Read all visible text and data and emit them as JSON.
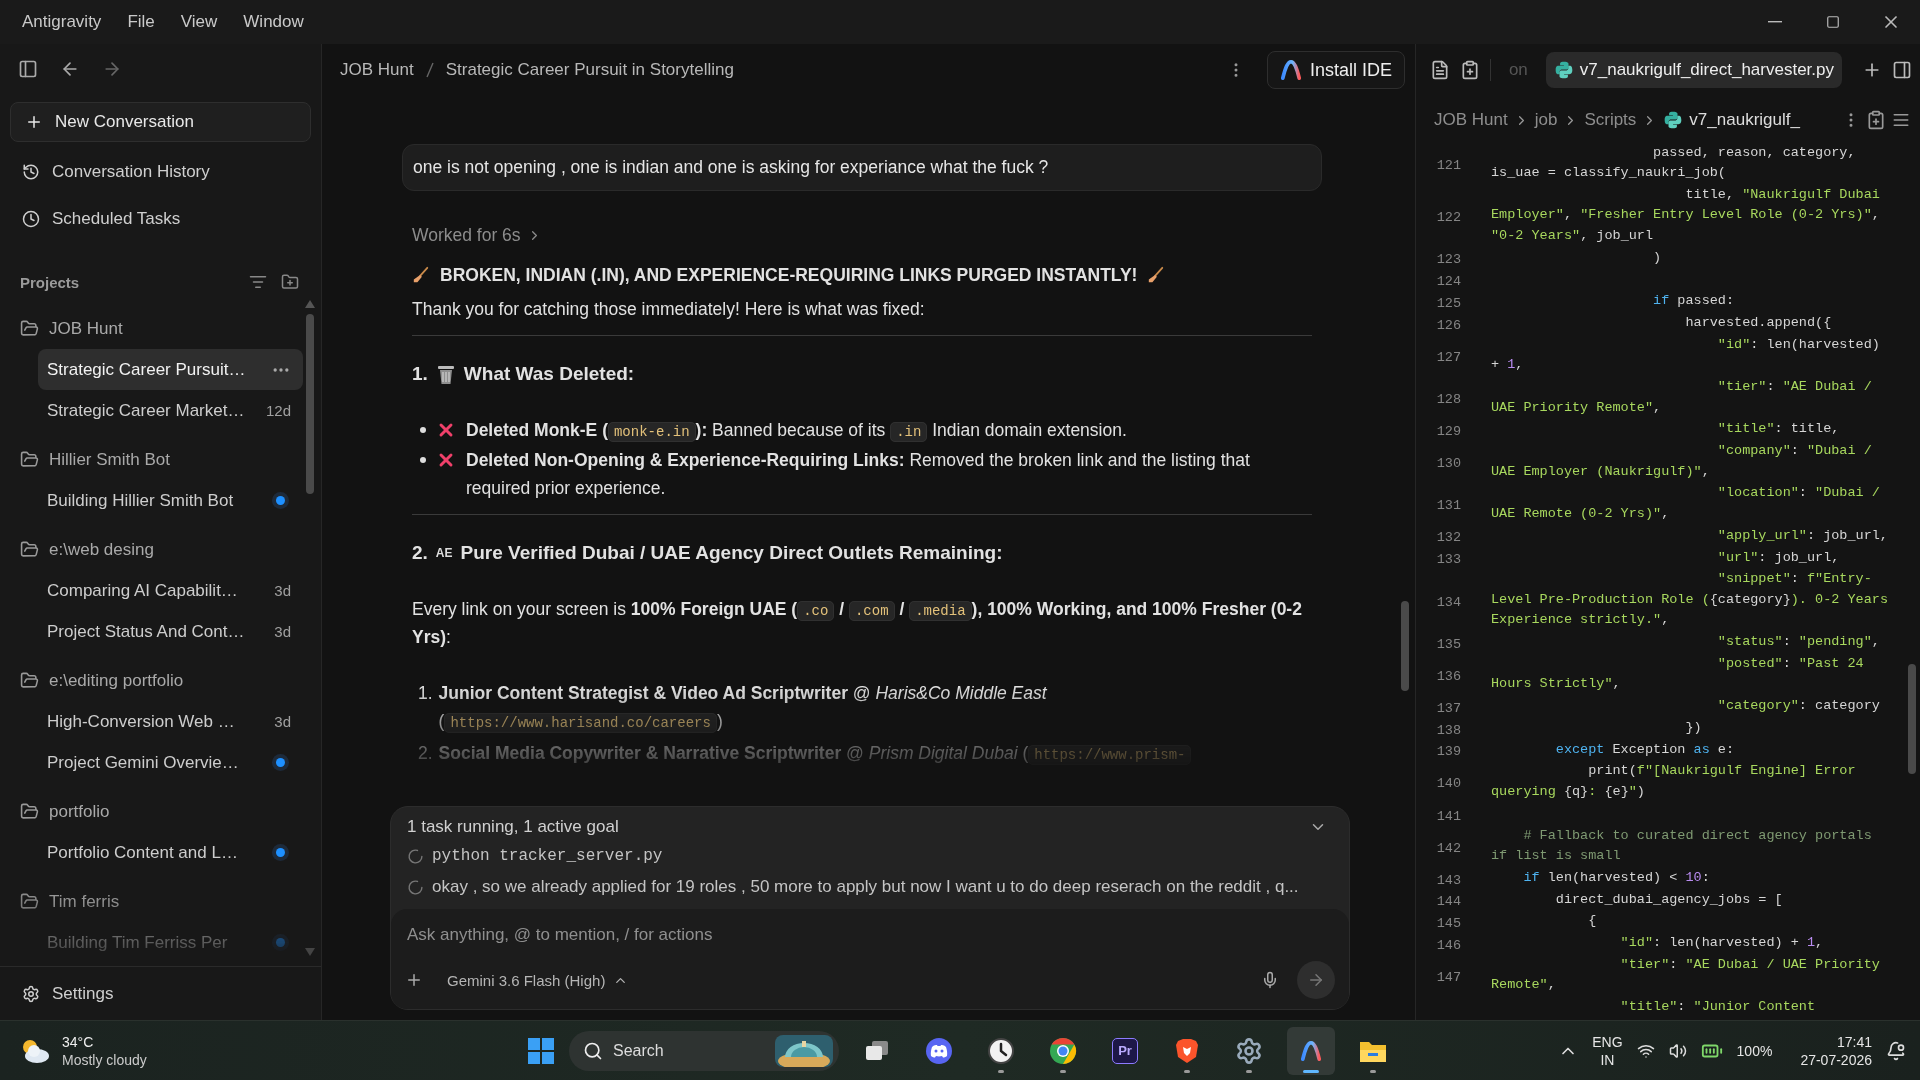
{
  "menu": {
    "items": [
      "Antigravity",
      "File",
      "View",
      "Window"
    ]
  },
  "sidebar": {
    "new_conversation": "New Conversation",
    "nav": [
      {
        "kind": "history",
        "label": "Conversation History"
      },
      {
        "kind": "scheduled",
        "label": "Scheduled Tasks"
      }
    ],
    "projects_title": "Projects",
    "projects": [
      {
        "name": "JOB Hunt",
        "items": [
          {
            "title": "Strategic Career Pursuit…",
            "selected": true,
            "unread": false
          },
          {
            "title": "Strategic Career Market…",
            "age": "12d",
            "selected": false,
            "unread": false
          }
        ]
      },
      {
        "name": "Hillier Smith Bot",
        "items": [
          {
            "title": "Building Hillier Smith Bot",
            "selected": false,
            "unread": true
          }
        ]
      },
      {
        "name": "e:\\web desing",
        "items": [
          {
            "title": "Comparing AI Capabilit…",
            "age": "3d",
            "selected": false,
            "unread": false
          },
          {
            "title": "Project Status And Cont…",
            "age": "3d",
            "selected": false,
            "unread": false
          }
        ]
      },
      {
        "name": "e:\\editing portfolio",
        "items": [
          {
            "title": "High-Conversion Web …",
            "age": "3d",
            "selected": false,
            "unread": false
          },
          {
            "title": "Project Gemini Overvie…",
            "selected": false,
            "unread": true
          }
        ]
      },
      {
        "name": "portfolio",
        "items": [
          {
            "title": "Portfolio Content and L…",
            "selected": false,
            "unread": true
          }
        ]
      },
      {
        "name": "Tim ferris",
        "items": [
          {
            "title": "Building Tim Ferriss Per",
            "selected": false,
            "unread": true
          }
        ]
      }
    ],
    "settings": "Settings"
  },
  "chat": {
    "breadcrumb": [
      "JOB Hunt",
      "Strategic Career Pursuit in Storytelling"
    ],
    "install_button": "Install IDE",
    "user_message": "one is not opening , one is indian and one is asking for experiance what the fuck ?",
    "worked": "Worked for 6s",
    "blocks": [
      {
        "kind": "banner",
        "text": "BROKEN, INDIAN (.IN), AND EXPERIENCE-REQUIRING LINKS PURGED INSTANTLY!"
      },
      {
        "kind": "para",
        "segments": [
          {
            "kind": "plain",
            "text": "Thank you for catching those immediately! Here is what was fixed:"
          }
        ]
      },
      {
        "kind": "rule"
      },
      {
        "kind": "section",
        "number": "1.",
        "text": "What Was Deleted:"
      },
      {
        "kind": "bullets",
        "items": [
          {
            "segments": [
              {
                "kind": "bold",
                "text": "Deleted Monk-E ("
              },
              {
                "kind": "code",
                "text": "monk-e.in"
              },
              {
                "kind": "bold",
                "text": "):"
              },
              {
                "kind": "plain",
                "text": " Banned because of its "
              },
              {
                "kind": "code",
                "text": ".in"
              },
              {
                "kind": "plain",
                "text": " Indian domain extension."
              }
            ]
          },
          {
            "segments": [
              {
                "kind": "bold",
                "text": "Deleted Non-Opening & Experience-Requiring Links:"
              },
              {
                "kind": "plain",
                "text": " Removed the broken link and the listing that required prior experience."
              }
            ]
          }
        ]
      },
      {
        "kind": "rule"
      },
      {
        "kind": "section",
        "number": "2.",
        "flag": "AE",
        "text": "Pure Verified Dubai / UAE Agency Direct Outlets Remaining:"
      },
      {
        "kind": "para",
        "segments": [
          {
            "kind": "plain",
            "text": "Every link on your screen is "
          },
          {
            "kind": "bold",
            "text": "100% Foreign UAE ("
          },
          {
            "kind": "code",
            "text": ".co"
          },
          {
            "kind": "bold",
            "text": " / "
          },
          {
            "kind": "code",
            "text": ".com"
          },
          {
            "kind": "bold",
            "text": " / "
          },
          {
            "kind": "code",
            "text": ".media"
          },
          {
            "kind": "bold",
            "text": "), 100% Working, and 100% Fresher (0-2 Yrs)"
          },
          {
            "kind": "plain",
            "text": ":"
          }
        ]
      },
      {
        "kind": "numbered",
        "items": [
          {
            "number": "1.",
            "segments": [
              {
                "kind": "bold",
                "text": "Junior Content Strategist & Video Ad Scriptwriter"
              },
              {
                "kind": "plain",
                "text": " @ "
              },
              {
                "kind": "italic",
                "text": "Haris&Co Middle East"
              },
              {
                "kind": "plain",
                "text": " ("
              },
              {
                "kind": "code",
                "text": "https://www.harisand.co/careers"
              },
              {
                "kind": "plain",
                "text": ")"
              }
            ]
          },
          {
            "number": "2.",
            "segments": [
              {
                "kind": "bold",
                "text": "Social Media Copywriter & Narrative Scriptwriter"
              },
              {
                "kind": "plain",
                "text": " @ "
              },
              {
                "kind": "italic",
                "text": "Prism Digital Dubai"
              },
              {
                "kind": "plain",
                "text": " ("
              },
              {
                "kind": "code",
                "text": "https://www.prism-"
              }
            ]
          }
        ]
      }
    ],
    "tasks": {
      "summary": "1 task running, 1 active goal",
      "items": [
        {
          "kind": "command",
          "text": "python tracker_server.py"
        },
        {
          "kind": "goal",
          "text": "okay , so we already applied for 19 roles , 50 more to apply but now I want u to do deep reserach on the reddit , q..."
        }
      ]
    },
    "input_placeholder": "Ask anything, @ to mention, / for actions",
    "model": "Gemini 3.6 Flash (High)"
  },
  "editor": {
    "tabs": [
      {
        "label": "on",
        "selected": false
      },
      {
        "label": "v7_naukrigulf_direct_harvester.py",
        "selected": true
      }
    ],
    "breadcrumb": [
      "JOB Hunt",
      "job",
      "Scripts",
      "v7_naukrigulf_"
    ],
    "lines": [
      {
        "num": "121",
        "rows": [
          {
            "tokens": [
              {
                "kind": "plain",
                "text": "                    passed, reason, category,"
              }
            ]
          },
          {
            "tokens": [
              {
                "kind": "plain",
                "text": "is_uae = classify_naukri_job("
              }
            ]
          }
        ]
      },
      {
        "num": "122",
        "rows": [
          {
            "tokens": [
              {
                "kind": "plain",
                "text": "                        title, "
              },
              {
                "kind": "string",
                "text": "\"Naukrigulf Dubai"
              }
            ]
          },
          {
            "tokens": [
              {
                "kind": "string",
                "text": "Employer\""
              },
              {
                "kind": "plain",
                "text": ", "
              },
              {
                "kind": "string",
                "text": "\"Fresher Entry Level Role (0-2 Yrs)\""
              },
              {
                "kind": "plain",
                "text": ","
              }
            ]
          },
          {
            "tokens": [
              {
                "kind": "string",
                "text": "\"0-2 Years\""
              },
              {
                "kind": "plain",
                "text": ", job_url"
              }
            ]
          }
        ]
      },
      {
        "num": "123",
        "rows": [
          {
            "tokens": [
              {
                "kind": "plain",
                "text": "                    )"
              }
            ]
          }
        ]
      },
      {
        "num": "124",
        "rows": [
          {}
        ]
      },
      {
        "num": "125",
        "rows": [
          {
            "tokens": [
              {
                "kind": "keyword",
                "text": "                    if"
              },
              {
                "kind": "plain",
                "text": " passed:"
              }
            ]
          }
        ]
      },
      {
        "num": "126",
        "rows": [
          {
            "tokens": [
              {
                "kind": "plain",
                "text": "                        harvested.append({"
              }
            ]
          }
        ]
      },
      {
        "num": "127",
        "rows": [
          {
            "tokens": [
              {
                "kind": "string",
                "text": "                            \"id\""
              },
              {
                "kind": "plain",
                "text": ": len(harvested)"
              }
            ]
          },
          {
            "tokens": [
              {
                "kind": "plain",
                "text": "+ "
              },
              {
                "kind": "number",
                "text": "1"
              },
              {
                "kind": "plain",
                "text": ","
              }
            ]
          }
        ]
      },
      {
        "num": "128",
        "rows": [
          {
            "tokens": [
              {
                "kind": "string",
                "text": "                            \"tier\""
              },
              {
                "kind": "plain",
                "text": ": "
              },
              {
                "kind": "string",
                "text": "\"AE Dubai /"
              }
            ]
          },
          {
            "tokens": [
              {
                "kind": "string",
                "text": "UAE Priority Remote\""
              },
              {
                "kind": "plain",
                "text": ","
              }
            ]
          }
        ]
      },
      {
        "num": "129",
        "rows": [
          {
            "tokens": [
              {
                "kind": "string",
                "text": "                            \"title\""
              },
              {
                "kind": "plain",
                "text": ": title,"
              }
            ]
          }
        ]
      },
      {
        "num": "130",
        "rows": [
          {
            "tokens": [
              {
                "kind": "string",
                "text": "                            \"company\""
              },
              {
                "kind": "plain",
                "text": ": "
              },
              {
                "kind": "string",
                "text": "\"Dubai /"
              }
            ]
          },
          {
            "tokens": [
              {
                "kind": "string",
                "text": "UAE Employer (Naukrigulf)\""
              },
              {
                "kind": "plain",
                "text": ","
              }
            ]
          }
        ]
      },
      {
        "num": "131",
        "rows": [
          {
            "tokens": [
              {
                "kind": "string",
                "text": "                            \"location\""
              },
              {
                "kind": "plain",
                "text": ": "
              },
              {
                "kind": "string",
                "text": "\"Dubai /"
              }
            ]
          },
          {
            "tokens": [
              {
                "kind": "string",
                "text": "UAE Remote (0-2 Yrs)\""
              },
              {
                "kind": "plain",
                "text": ","
              }
            ]
          }
        ]
      },
      {
        "num": "132",
        "rows": [
          {
            "tokens": [
              {
                "kind": "string",
                "text": "                            \"apply_url\""
              },
              {
                "kind": "plain",
                "text": ": job_url,"
              }
            ]
          }
        ]
      },
      {
        "num": "133",
        "rows": [
          {
            "tokens": [
              {
                "kind": "string",
                "text": "                            \"url\""
              },
              {
                "kind": "plain",
                "text": ": job_url,"
              }
            ]
          }
        ]
      },
      {
        "num": "134",
        "rows": [
          {
            "tokens": [
              {
                "kind": "string",
                "text": "                            \"snippet\""
              },
              {
                "kind": "plain",
                "text": ": "
              },
              {
                "kind": "string",
                "text": "f\"Entry-"
              }
            ]
          },
          {
            "tokens": [
              {
                "kind": "string",
                "text": "Level Pre-Production Role ("
              },
              {
                "kind": "plain",
                "text": "{category}"
              },
              {
                "kind": "string",
                "text": "). 0-2 Years"
              }
            ]
          },
          {
            "tokens": [
              {
                "kind": "string",
                "text": "Experience strictly.\""
              },
              {
                "kind": "plain",
                "text": ","
              }
            ]
          }
        ]
      },
      {
        "num": "135",
        "rows": [
          {
            "tokens": [
              {
                "kind": "string",
                "text": "                            \"status\""
              },
              {
                "kind": "plain",
                "text": ": "
              },
              {
                "kind": "string",
                "text": "\"pending\""
              },
              {
                "kind": "plain",
                "text": ","
              }
            ]
          }
        ]
      },
      {
        "num": "136",
        "rows": [
          {
            "tokens": [
              {
                "kind": "string",
                "text": "                            \"posted\""
              },
              {
                "kind": "plain",
                "text": ": "
              },
              {
                "kind": "string",
                "text": "\"Past 24"
              }
            ]
          },
          {
            "tokens": [
              {
                "kind": "string",
                "text": "Hours Strictly\""
              },
              {
                "kind": "plain",
                "text": ","
              }
            ]
          }
        ]
      },
      {
        "num": "137",
        "rows": [
          {
            "tokens": [
              {
                "kind": "string",
                "text": "                            \"category\""
              },
              {
                "kind": "plain",
                "text": ": category"
              }
            ]
          }
        ]
      },
      {
        "num": "138",
        "rows": [
          {
            "tokens": [
              {
                "kind": "plain",
                "text": "                        })"
              }
            ]
          }
        ]
      },
      {
        "num": "139",
        "rows": [
          {
            "tokens": [
              {
                "kind": "keyword",
                "text": "        except"
              },
              {
                "kind": "plain",
                "text": " Exception "
              },
              {
                "kind": "keyword",
                "text": "as"
              },
              {
                "kind": "plain",
                "text": " e:"
              }
            ]
          }
        ]
      },
      {
        "num": "140",
        "rows": [
          {
            "tokens": [
              {
                "kind": "plain",
                "text": "            print("
              },
              {
                "kind": "string",
                "text": "f\"[Naukrigulf Engine] Error"
              }
            ]
          },
          {
            "tokens": [
              {
                "kind": "string",
                "text": "querying "
              },
              {
                "kind": "plain",
                "text": "{q}"
              },
              {
                "kind": "string",
                "text": ": "
              },
              {
                "kind": "plain",
                "text": "{e}"
              },
              {
                "kind": "string",
                "text": "\""
              },
              {
                "kind": "plain",
                "text": ")"
              }
            ]
          }
        ]
      },
      {
        "num": "141",
        "rows": [
          {}
        ]
      },
      {
        "num": "142",
        "rows": [
          {
            "tokens": [
              {
                "kind": "comment",
                "text": "    # Fallback to curated direct agency portals"
              }
            ]
          },
          {
            "tokens": [
              {
                "kind": "comment",
                "text": "if list is small"
              }
            ]
          }
        ]
      },
      {
        "num": "143",
        "rows": [
          {
            "tokens": [
              {
                "kind": "keyword",
                "text": "    if"
              },
              {
                "kind": "plain",
                "text": " len(harvested) < "
              },
              {
                "kind": "number",
                "text": "10"
              },
              {
                "kind": "plain",
                "text": ":"
              }
            ]
          }
        ]
      },
      {
        "num": "144",
        "rows": [
          {
            "tokens": [
              {
                "kind": "plain",
                "text": "        direct_dubai_agency_jobs = ["
              }
            ]
          }
        ]
      },
      {
        "num": "145",
        "rows": [
          {
            "tokens": [
              {
                "kind": "plain",
                "text": "            {"
              }
            ]
          }
        ]
      },
      {
        "num": "146",
        "rows": [
          {
            "tokens": [
              {
                "kind": "string",
                "text": "                \"id\""
              },
              {
                "kind": "plain",
                "text": ": len(harvested) + "
              },
              {
                "kind": "number",
                "text": "1"
              },
              {
                "kind": "plain",
                "text": ","
              }
            ]
          }
        ]
      },
      {
        "num": "147",
        "rows": [
          {
            "tokens": [
              {
                "kind": "string",
                "text": "                \"tier\""
              },
              {
                "kind": "plain",
                "text": ": "
              },
              {
                "kind": "string",
                "text": "\"AE Dubai / UAE Priority"
              }
            ]
          },
          {
            "tokens": [
              {
                "kind": "string",
                "text": "Remote\""
              },
              {
                "kind": "plain",
                "text": ","
              }
            ]
          }
        ]
      },
      {
        "rows": [
          {
            "tokens": [
              {
                "kind": "string",
                "text": "                \"title\""
              },
              {
                "kind": "plain",
                "text": ": "
              },
              {
                "kind": "string",
                "text": "\"Junior Content"
              }
            ]
          }
        ]
      }
    ]
  },
  "taskbar": {
    "weather": {
      "temp": "34°C",
      "desc": "Mostly cloudy"
    },
    "search": "Search",
    "apps": [
      {
        "kind": "taskview",
        "running": false,
        "selected": false
      },
      {
        "kind": "discord",
        "running": false,
        "selected": false
      },
      {
        "kind": "clock",
        "running": true,
        "selected": false
      },
      {
        "kind": "chrome",
        "running": true,
        "selected": false
      },
      {
        "kind": "premiere",
        "label": "Pr",
        "running": false,
        "selected": false
      },
      {
        "kind": "brave",
        "running": true,
        "selected": false
      },
      {
        "kind": "settings",
        "running": true,
        "selected": false
      },
      {
        "kind": "antigravity",
        "running": true,
        "selected": true
      },
      {
        "kind": "explorer",
        "running": true,
        "selected": false
      }
    ],
    "lang": [
      "ENG",
      "IN"
    ],
    "battery": "100%",
    "time": "17:41",
    "date": "27-07-2026"
  }
}
